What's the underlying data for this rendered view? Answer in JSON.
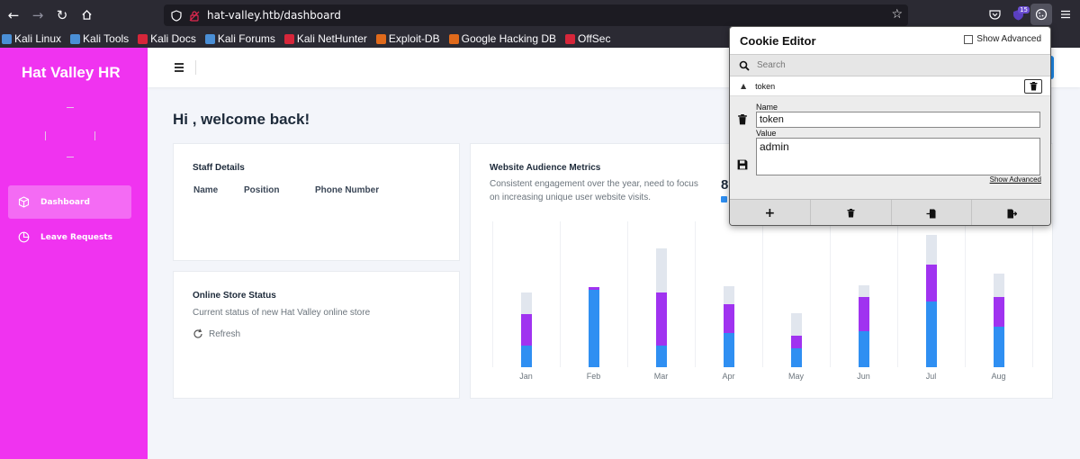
{
  "browser": {
    "url": "hat-valley.htb/dashboard",
    "ext_badge": "15",
    "bookmarks": [
      {
        "label": "Kali Linux",
        "color": "#4a8fd6"
      },
      {
        "label": "Kali Tools",
        "color": "#4a8fd6"
      },
      {
        "label": "Kali Docs",
        "color": "#d6263a"
      },
      {
        "label": "Kali Forums",
        "color": "#4a8fd6"
      },
      {
        "label": "Kali NetHunter",
        "color": "#d6263a"
      },
      {
        "label": "Exploit-DB",
        "color": "#e06a1b"
      },
      {
        "label": "Google Hacking DB",
        "color": "#e06a1b"
      },
      {
        "label": "OffSec",
        "color": "#d6263a"
      }
    ]
  },
  "sidebar": {
    "brand": "Hat Valley HR",
    "items": [
      {
        "label": "Dashboard",
        "active": true,
        "icon": "cube-icon"
      },
      {
        "label": "Leave Requests",
        "active": false,
        "icon": "pie-chart-icon"
      }
    ]
  },
  "main": {
    "welcome": "Hi , welcome back!",
    "staff": {
      "title": "Staff Details",
      "columns": [
        "Name",
        "Position",
        "Phone Number"
      ]
    },
    "store": {
      "title": "Online Store Status",
      "subtitle": "Current status of new Hat Valley online store",
      "refresh_label": "Refresh"
    },
    "audience": {
      "title": "Website Audience Metrics",
      "description_line1": "Consistent engagement over the year, need to focus",
      "description_line2": "on increasing unique user website visits.",
      "partial_stat": "8"
    }
  },
  "chart_data": {
    "type": "bar",
    "stacked": true,
    "categories": [
      "Jan",
      "Feb",
      "Mar",
      "Apr",
      "May",
      "Jun",
      "Jul",
      "Aug"
    ],
    "colors": {
      "blue": "#2f8ff2",
      "purple": "#a033f0",
      "gray": "#e1e6ee"
    },
    "ylim": [
      0,
      150
    ],
    "series": [
      {
        "values": [
          22,
          80,
          22,
          35,
          19,
          37,
          68,
          42
        ]
      },
      {
        "values": [
          33,
          2,
          55,
          30,
          13,
          35,
          38,
          30
        ]
      },
      {
        "values": [
          22,
          0,
          45,
          18,
          24,
          12,
          30,
          24
        ]
      }
    ]
  },
  "cookie_editor": {
    "title": "Cookie Editor",
    "show_advanced_label": "Show Advanced",
    "search_placeholder": "Search",
    "cookie_name": "token",
    "name_label": "Name",
    "name_value": "token",
    "value_label": "Value",
    "value_value": "admin",
    "show_advanced_link": "Show Advanced",
    "actions": [
      "+",
      "trash-icon",
      "import-icon",
      "export-icon"
    ]
  }
}
